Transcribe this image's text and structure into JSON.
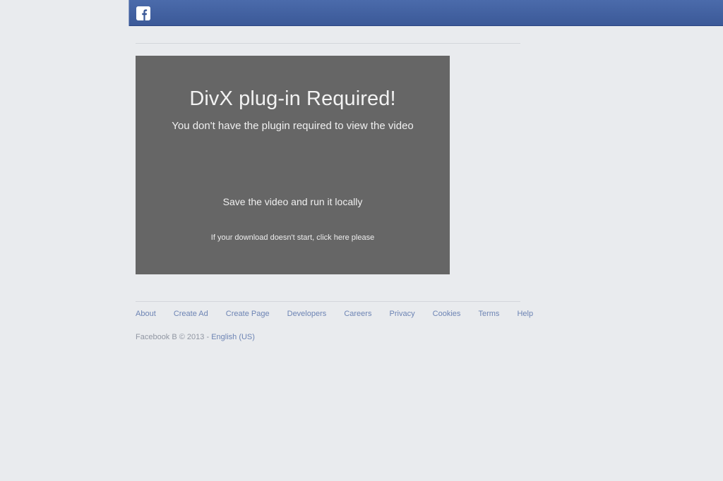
{
  "header": {
    "logo_icon": "facebook-f-logo-icon",
    "brand_color": "#3b5998",
    "logo_letter": "f"
  },
  "video": {
    "background_color": "#666666",
    "title": "DivX plug-in Required!",
    "subtitle": "You don't have the plugin required to view the video",
    "save_text": "Save the video and run it locally",
    "download_hint": "If your download doesn't start, click here please"
  },
  "footer": {
    "links": [
      {
        "label": "About"
      },
      {
        "label": "Create Ad"
      },
      {
        "label": "Create Page"
      },
      {
        "label": "Developers"
      },
      {
        "label": "Careers"
      },
      {
        "label": "Privacy"
      },
      {
        "label": "Cookies"
      },
      {
        "label": "Terms"
      },
      {
        "label": "Help"
      }
    ],
    "link_color": "#6d84b4",
    "copyright": "Facebook B © 2013",
    "separator": "-",
    "language": "English (US)"
  },
  "page": {
    "background_color": "#e9ebee"
  }
}
